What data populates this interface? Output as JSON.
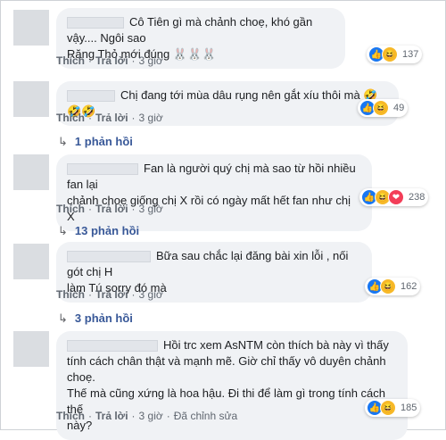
{
  "comments": [
    {
      "text_line1": "Cô Tiên gì mà chảnh choẹ, khó gần vậy.... Ngôi sao",
      "text_line2": "Răng Thỏ mới đúng 🐰🐰🐰",
      "actions": {
        "like": "Thích",
        "reply": "Trả lời",
        "time": "3 giờ"
      },
      "reactions": [
        "like",
        "haha"
      ],
      "count": "137"
    },
    {
      "text_line1": "Chị đang tới mùa dâu rụng nên gắt xíu thôi mà 🤣🤣🤣",
      "actions": {
        "like": "Thích",
        "reply": "Trả lời",
        "time": "3 giờ"
      },
      "reactions": [
        "like",
        "haha"
      ],
      "count": "49",
      "replies": "1 phản hồi"
    },
    {
      "text_line1": "Fan là người quý chị mà sao từ hồi nhiều fan lại",
      "text_line2": "chảnh choẹ giống chị X rồi có ngày mất hết fan như chị X",
      "actions": {
        "like": "Thích",
        "reply": "Trả lời",
        "time": "3 giờ"
      },
      "reactions": [
        "like",
        "haha",
        "love"
      ],
      "count": "238",
      "replies": "13 phản hồi"
    },
    {
      "text_line1": "Bữa sau chắc lại đăng bài xin lỗi , nối gót chị H",
      "text_line2": "làm Tú sorry đó mà",
      "actions": {
        "like": "Thích",
        "reply": "Trả lời",
        "time": "3 giờ"
      },
      "reactions": [
        "like",
        "haha"
      ],
      "count": "162",
      "replies": "3 phản hồi"
    },
    {
      "text_line1": "Hồi trc xem AsNTM còn thích bà này vì thấy",
      "text_line2": "tính cách chân thật và mạnh mẽ. Giờ chỉ thấy vô duyên chảnh choẹ.",
      "text_line3": "Thế mà cũng xứng là hoa hậu. Đi thi để làm gì trong tính cách thế",
      "text_line4": "này?",
      "actions": {
        "like": "Thích",
        "reply": "Trả lời",
        "time": "3 giờ",
        "edited": "Đã chỉnh sửa"
      },
      "reactions": [
        "like",
        "haha"
      ],
      "count": "185"
    }
  ],
  "icons": {
    "like": "👍",
    "haha": "😆",
    "love": "❤"
  }
}
